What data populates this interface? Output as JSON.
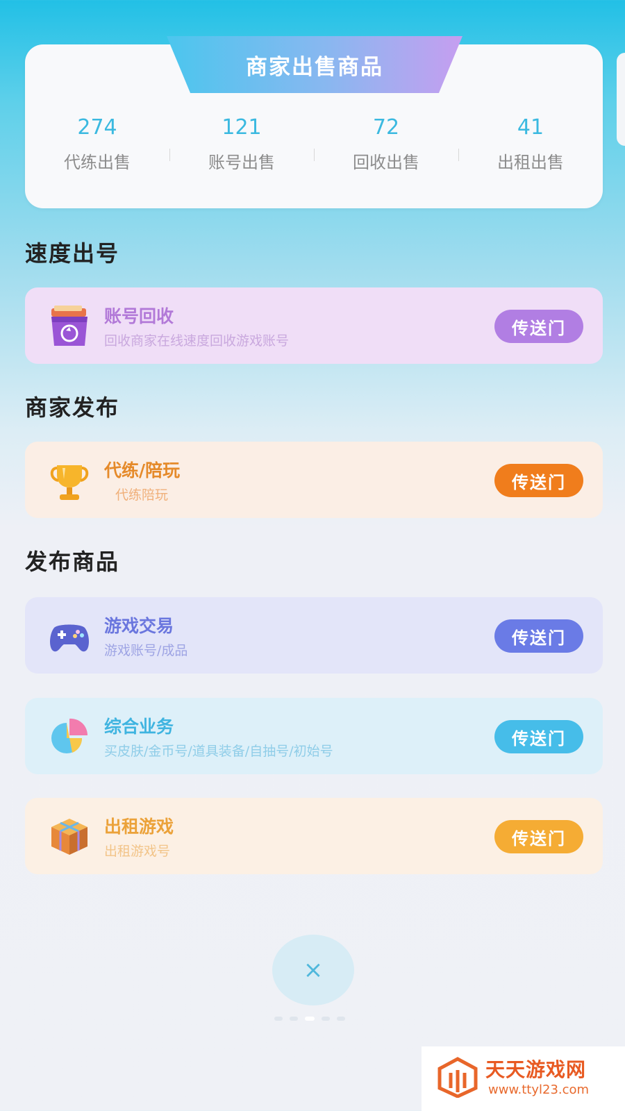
{
  "header": {
    "title": "商家出售商品",
    "stats": [
      {
        "value": "274",
        "label": "代练出售"
      },
      {
        "value": "121",
        "label": "账号出售"
      },
      {
        "value": "72",
        "label": "回收出售"
      },
      {
        "value": "41",
        "label": "出租出售"
      }
    ]
  },
  "sections": [
    {
      "title": "速度出号",
      "items": [
        {
          "icon": "recycle-box-icon",
          "title": "账号回收",
          "subtitle": "回收商家在线速度回收游戏账号",
          "button": "传送门",
          "bg": "#f0def7",
          "title_color": "#b279d8",
          "sub_color": "#c9a8de",
          "btn_color": "#b17ee3"
        }
      ]
    },
    {
      "title": "商家发布",
      "items": [
        {
          "icon": "trophy-icon",
          "title": "代练/陪玩",
          "subtitle": "代练陪玩",
          "button": "传送门",
          "bg": "#fbeee5",
          "title_color": "#e58a2a",
          "sub_color": "#f0b07a",
          "btn_color": "#f07d1c"
        }
      ]
    },
    {
      "title": "发布商品",
      "items": [
        {
          "icon": "gamepad-icon",
          "title": "游戏交易",
          "subtitle": "游戏账号/成品",
          "button": "传送门",
          "bg": "#e3e5f9",
          "title_color": "#6a76de",
          "sub_color": "#9ea4e4",
          "btn_color": "#6a7be6"
        },
        {
          "icon": "pie-chart-icon",
          "title": "综合业务",
          "subtitle": "买皮肤/金币号/道具装备/自抽号/初始号",
          "button": "传送门",
          "bg": "#ddf0f9",
          "title_color": "#3fb4e0",
          "sub_color": "#8fcde8",
          "btn_color": "#46bde9"
        },
        {
          "icon": "cube-icon",
          "title": "出租游戏",
          "subtitle": "出租游戏号",
          "button": "传送门",
          "bg": "#fcf0e4",
          "title_color": "#eba23a",
          "sub_color": "#f2c488",
          "btn_color": "#f5ac34"
        }
      ]
    }
  ],
  "close": {
    "label": "×"
  },
  "watermark": {
    "name": "天天游戏网",
    "url": "www.ttyl23.com"
  }
}
